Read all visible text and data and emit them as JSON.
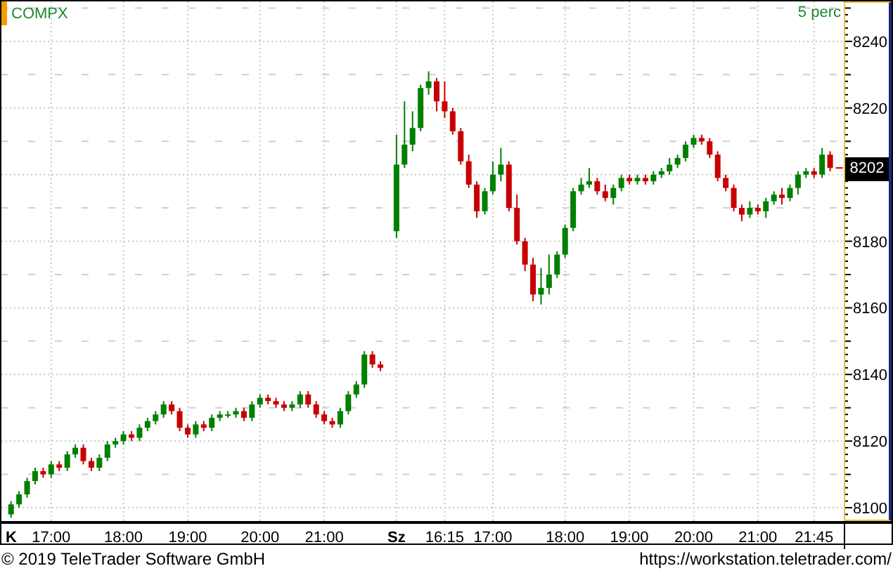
{
  "chart": {
    "symbol": "COMPX",
    "interval": "5 perc",
    "last_price": "8202",
    "chart_data": {
      "type": "candlestick",
      "grid": true,
      "ylim": [
        8096,
        8252
      ],
      "yticks": [
        8100,
        8120,
        8140,
        8160,
        8180,
        8220,
        8240
      ],
      "categories": [
        "K",
        null,
        null,
        null,
        null,
        "17:00",
        null,
        null,
        null,
        null,
        null,
        null,
        null,
        null,
        "18:00",
        null,
        null,
        null,
        null,
        null,
        null,
        null,
        "19:00",
        null,
        null,
        null,
        null,
        null,
        null,
        null,
        null,
        "20:00",
        null,
        null,
        null,
        null,
        null,
        null,
        null,
        "21:00",
        null,
        null,
        null,
        null,
        null,
        null,
        null,
        null,
        "Sz",
        null,
        null,
        null,
        null,
        null,
        "16:15",
        null,
        null,
        null,
        null,
        null,
        "17:00",
        null,
        null,
        null,
        null,
        null,
        null,
        null,
        null,
        "18:00",
        null,
        null,
        null,
        null,
        null,
        null,
        null,
        "19:00",
        null,
        null,
        null,
        null,
        null,
        null,
        null,
        "20:00",
        null,
        null,
        null,
        null,
        null,
        null,
        null,
        "21:00",
        null,
        null,
        null,
        null,
        null,
        null,
        "21:45",
        null,
        null
      ],
      "ohlc": [
        [
          8098,
          8102,
          8097,
          8101
        ],
        [
          8101,
          8105,
          8100,
          8104
        ],
        [
          8104,
          8109,
          8103,
          8108
        ],
        [
          8108,
          8112,
          8107,
          8111
        ],
        [
          8111,
          8112,
          8109,
          8110
        ],
        [
          8110,
          8114,
          8109,
          8113
        ],
        [
          8113,
          8114,
          8111,
          8112
        ],
        [
          8112,
          8117,
          8111,
          8116
        ],
        [
          8116,
          8119,
          8115,
          8118
        ],
        [
          8118,
          8119,
          8113,
          8114
        ],
        [
          8114,
          8115,
          8111,
          8112
        ],
        [
          8112,
          8116,
          8111,
          8115
        ],
        [
          8115,
          8120,
          8114,
          8119
        ],
        [
          8119,
          8121,
          8118,
          8120
        ],
        [
          8120,
          8123,
          8119,
          8122
        ],
        [
          8122,
          8123,
          8120,
          8121
        ],
        [
          8121,
          8125,
          8120,
          8124
        ],
        [
          8124,
          8127,
          8123,
          8126
        ],
        [
          8126,
          8129,
          8125,
          8128
        ],
        [
          8128,
          8132,
          8127,
          8131
        ],
        [
          8131,
          8132,
          8128,
          8129
        ],
        [
          8129,
          8130,
          8123,
          8124
        ],
        [
          8124,
          8125,
          8121,
          8122
        ],
        [
          8122,
          8126,
          8121,
          8125
        ],
        [
          8125,
          8126,
          8123,
          8124
        ],
        [
          8124,
          8128,
          8123,
          8127
        ],
        [
          8127,
          8129,
          8126,
          8128
        ],
        [
          8128,
          8129,
          8127,
          8128
        ],
        [
          8128,
          8130,
          8127,
          8129
        ],
        [
          8129,
          8130,
          8126,
          8127
        ],
        [
          8127,
          8132,
          8126,
          8131
        ],
        [
          8131,
          8134,
          8130,
          8133
        ],
        [
          8133,
          8134,
          8131,
          8132
        ],
        [
          8132,
          8133,
          8130,
          8131
        ],
        [
          8131,
          8132,
          8129,
          8130
        ],
        [
          8130,
          8132,
          8129,
          8131
        ],
        [
          8131,
          8135,
          8130,
          8134
        ],
        [
          8134,
          8135,
          8130,
          8131
        ],
        [
          8131,
          8132,
          8127,
          8128
        ],
        [
          8128,
          8129,
          8125,
          8126
        ],
        [
          8126,
          8127,
          8124,
          8125
        ],
        [
          8125,
          8130,
          8124,
          8129
        ],
        [
          8129,
          8135,
          8128,
          8134
        ],
        [
          8134,
          8138,
          8133,
          8137
        ],
        [
          8137,
          8147,
          8136,
          8146
        ],
        [
          8146,
          8147,
          8142,
          8143
        ],
        [
          8143,
          8144,
          8141,
          8142
        ],
        null,
        [
          8183,
          8212,
          8181,
          8203
        ],
        [
          8203,
          8222,
          8202,
          8209
        ],
        [
          8209,
          8219,
          8207,
          8214
        ],
        [
          8214,
          8227,
          8213,
          8226
        ],
        [
          8226,
          8231,
          8224,
          8228
        ],
        [
          8228,
          8229,
          8219,
          8222
        ],
        [
          8222,
          8228,
          8217,
          8219
        ],
        [
          8219,
          8220,
          8212,
          8213
        ],
        [
          8213,
          8214,
          8203,
          8204
        ],
        [
          8204,
          8206,
          8196,
          8197
        ],
        [
          8197,
          8198,
          8187,
          8189
        ],
        [
          8189,
          8196,
          8188,
          8195
        ],
        [
          8195,
          8204,
          8194,
          8200
        ],
        [
          8200,
          8208,
          8198,
          8203
        ],
        [
          8203,
          8204,
          8189,
          8190
        ],
        [
          8190,
          8194,
          8179,
          8180
        ],
        [
          8180,
          8181,
          8171,
          8173
        ],
        [
          8173,
          8175,
          8162,
          8164
        ],
        [
          8164,
          8172,
          8161,
          8166
        ],
        [
          8166,
          8176,
          8164,
          8170
        ],
        [
          8170,
          8177,
          8169,
          8176
        ],
        [
          8176,
          8185,
          8175,
          8184
        ],
        [
          8184,
          8196,
          8183,
          8195
        ],
        [
          8195,
          8199,
          8194,
          8197
        ],
        [
          8197,
          8202,
          8196,
          8198
        ],
        [
          8198,
          8199,
          8194,
          8195
        ],
        [
          8195,
          8197,
          8192,
          8193
        ],
        [
          8193,
          8197,
          8191,
          8196
        ],
        [
          8196,
          8200,
          8195,
          8199
        ],
        [
          8199,
          8200,
          8197,
          8198
        ],
        [
          8198,
          8200,
          8197,
          8199
        ],
        [
          8199,
          8200,
          8197,
          8198
        ],
        [
          8198,
          8201,
          8197,
          8200
        ],
        [
          8200,
          8202,
          8199,
          8201
        ],
        [
          8201,
          8205,
          8200,
          8203
        ],
        [
          8203,
          8206,
          8202,
          8205
        ],
        [
          8205,
          8210,
          8204,
          8209
        ],
        [
          8209,
          8212,
          8208,
          8211
        ],
        [
          8211,
          8212,
          8209,
          8210
        ],
        [
          8210,
          8211,
          8205,
          8206
        ],
        [
          8206,
          8207,
          8198,
          8199
        ],
        [
          8199,
          8200,
          8195,
          8196
        ],
        [
          8196,
          8197,
          8189,
          8190
        ],
        [
          8190,
          8191,
          8186,
          8188
        ],
        [
          8188,
          8192,
          8187,
          8190
        ],
        [
          8190,
          8191,
          8188,
          8189
        ],
        [
          8189,
          8193,
          8187,
          8192
        ],
        [
          8192,
          8195,
          8191,
          8194
        ],
        [
          8194,
          8196,
          8191,
          8193
        ],
        [
          8193,
          8197,
          8192,
          8196
        ],
        [
          8196,
          8201,
          8194,
          8200
        ],
        [
          8200,
          8202,
          8199,
          8201
        ],
        [
          8201,
          8202,
          8199,
          8200
        ],
        [
          8200,
          8208,
          8199,
          8206
        ],
        [
          8206,
          8207,
          8201,
          8202
        ]
      ]
    }
  },
  "footer": {
    "copyright": "© 2019 TeleTrader Software GmbH",
    "url": "https://workstation.teletrader.com/"
  }
}
